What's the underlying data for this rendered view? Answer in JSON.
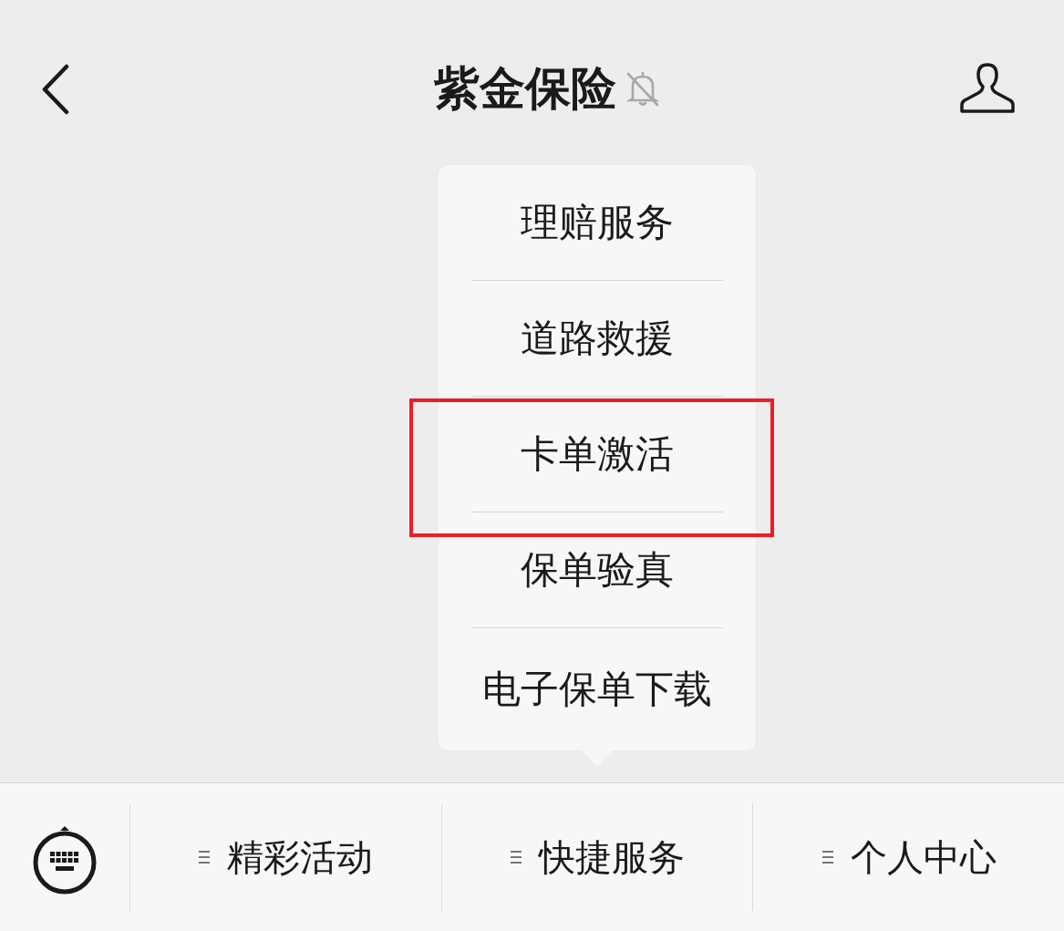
{
  "header": {
    "title": "紫金保险",
    "muted": true
  },
  "bottom_menu": {
    "tabs": [
      {
        "label": "精彩活动"
      },
      {
        "label": "快捷服务",
        "submenu": [
          {
            "label": "理赔服务",
            "highlighted": false
          },
          {
            "label": "道路救援",
            "highlighted": false
          },
          {
            "label": "卡单激活",
            "highlighted": true
          },
          {
            "label": "保单验真",
            "highlighted": false
          },
          {
            "label": "电子保单下载",
            "highlighted": false
          }
        ]
      },
      {
        "label": "个人中心"
      }
    ]
  }
}
